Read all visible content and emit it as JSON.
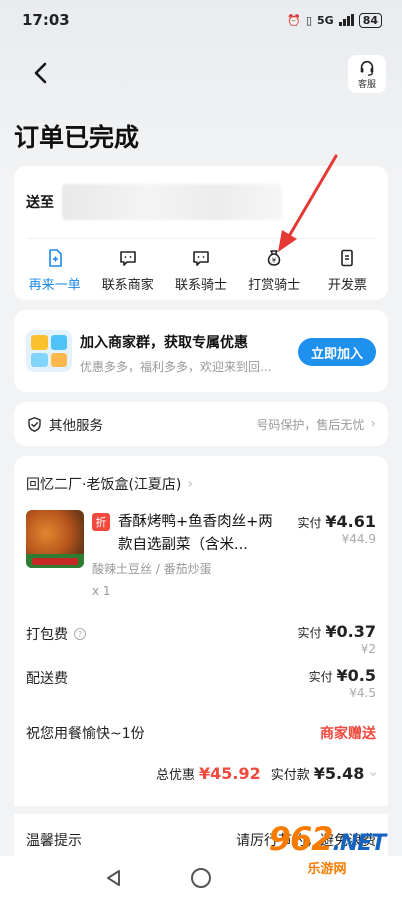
{
  "status_bar": {
    "time": "17:03",
    "network": "5G",
    "battery": "84"
  },
  "header": {
    "title": "订单已完成",
    "service_label": "客服"
  },
  "address": {
    "label": "送至"
  },
  "actions": [
    {
      "label": "再来一单",
      "icon": "reorder-icon"
    },
    {
      "label": "联系商家",
      "icon": "chat-icon"
    },
    {
      "label": "联系骑士",
      "icon": "chat-icon"
    },
    {
      "label": "打赏骑士",
      "icon": "money-bag-icon"
    },
    {
      "label": "开发票",
      "icon": "invoice-icon"
    }
  ],
  "promo": {
    "title": "加入商家群，获取专属优惠",
    "subtitle": "优惠多多，福利多多，欢迎来到回...",
    "button": "立即加入"
  },
  "other_services": {
    "label": "其他服务",
    "hint": "号码保护，售后无忧"
  },
  "order": {
    "store_name": "回忆二厂·老饭盒(江夏店)",
    "discount_tag": "折",
    "item": {
      "name": "香酥烤鸭+鱼香肉丝+两款自选副菜（含米...",
      "options": "酸辣土豆丝 / 番茄炒蛋",
      "quantity": "x 1",
      "paid_prefix": "实付",
      "paid": "¥4.61",
      "original": "¥44.9"
    },
    "packing_fee": {
      "label": "打包费",
      "paid_prefix": "实付",
      "paid": "¥0.37",
      "original": "¥2"
    },
    "delivery_fee": {
      "label": "配送费",
      "paid_prefix": "实付",
      "paid": "¥0.5",
      "original": "¥4.5"
    },
    "gift": {
      "label": "祝您用餐愉快~1份",
      "value": "商家赠送"
    },
    "summary": {
      "discount_label": "总优惠",
      "discount": "¥45.92",
      "total_label": "实付款",
      "total": "¥5.48"
    },
    "tip": {
      "label": "温馨提示",
      "value": "请厉行节约，避免浪费"
    }
  },
  "watermark": {
    "number": "962",
    "domain": ".NET",
    "site": "乐游网"
  },
  "colors": {
    "accent": "#1e88e5",
    "red": "#f04a3e",
    "button": "#1e90ee"
  }
}
